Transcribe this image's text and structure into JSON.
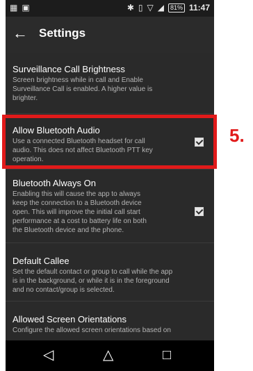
{
  "status_bar": {
    "left_icons": [
      "contacts-icon",
      "image-icon"
    ],
    "right_icons": [
      "bluetooth-icon",
      "vibrate-icon",
      "wifi-icon",
      "signal-icon"
    ],
    "battery": "81%",
    "time": "11:47"
  },
  "app_bar": {
    "title": "Settings"
  },
  "settings": [
    {
      "title": "Surveillance Call Brightness",
      "desc": [
        "Screen brightness while in call and Enable",
        "Surveillance Call is enabled. A higher value is",
        "brighter."
      ]
    },
    {
      "title": "Allow Bluetooth Audio",
      "desc": [
        "Use a connected Bluetooth headset for call",
        "audio. This does not affect Bluetooth PTT key",
        "operation."
      ],
      "checked": true
    },
    {
      "title": "Bluetooth Always On",
      "desc": [
        "Enabling this will cause the app to always",
        "keep the connection to a Bluetooth device",
        "open. This will improve the initial call start",
        "performance at a cost to battery life on both",
        "the Bluetooth device and the phone."
      ],
      "checked": true
    },
    {
      "title": "Default Callee",
      "desc": [
        "Set the default contact or group to call while the app",
        "is in the background, or while it is in the foreground",
        "and no contact/group is selected."
      ]
    },
    {
      "title": "Allowed Screen Orientations",
      "desc": [
        "Configure the allowed screen orientations based on"
      ]
    }
  ],
  "nav_bar": {
    "back": "◁",
    "home": "△",
    "recents": "□"
  },
  "annotation": {
    "step": "5."
  },
  "colors": {
    "highlight": "#e11a1a",
    "background": "#2a2a2a"
  }
}
